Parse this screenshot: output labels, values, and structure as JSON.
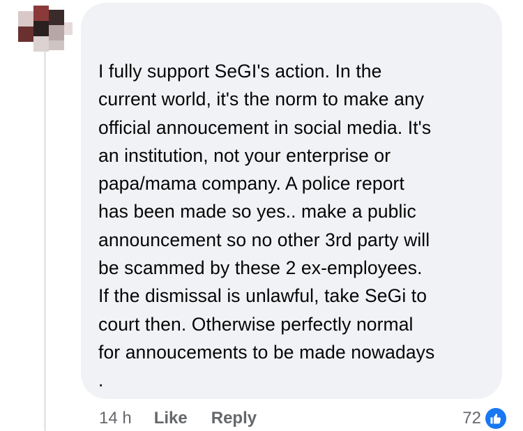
{
  "comment": {
    "lines": [
      "I fully support SeGI's action. In the",
      "current world, it's the norm to make any",
      "official annoucement in social media. It's",
      "an institution, not your enterprise or",
      "papa/mama company. A police report",
      "has been made so yes.. make a public",
      "announcement so no other 3rd party will",
      "be scammed by these 2 ex-employees.",
      "If the dismissal is unlawful, take SeGi to",
      "court then. Otherwise perfectly normal",
      "for annoucements to be made nowadays",
      "."
    ]
  },
  "actions": {
    "time": "14 h",
    "like_label": "Like",
    "reply_label": "Reply"
  },
  "reactions": {
    "count": "72",
    "icon": "thumbs-up-icon",
    "badge_color": "#1877f2"
  },
  "colors": {
    "bubble": "#f0f2f5",
    "text": "#050505",
    "meta": "#65676b"
  }
}
